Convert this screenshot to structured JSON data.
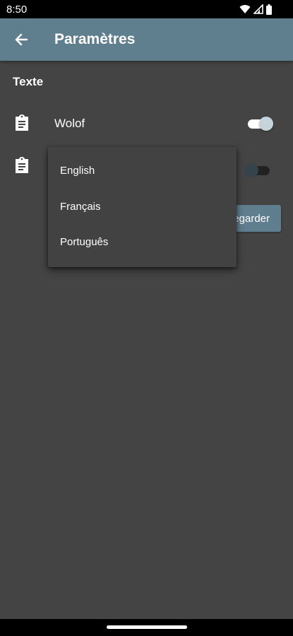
{
  "status_bar": {
    "time": "8:50",
    "icons": [
      "wifi-icon",
      "signal-icon",
      "battery-icon"
    ]
  },
  "app_bar": {
    "title": "Paramètres",
    "back_icon": "arrow-back-icon",
    "color": "#5f7e8e"
  },
  "section": {
    "title": "Texte"
  },
  "rows": [
    {
      "label": "Wolof",
      "icon": "clipboard-icon",
      "switch_on": true
    },
    {
      "label": "",
      "icon": "clipboard-icon",
      "switch_on": false
    }
  ],
  "save_button": {
    "label": "egarder"
  },
  "menu": {
    "items": [
      {
        "label": "English"
      },
      {
        "label": "Français"
      },
      {
        "label": "Português"
      }
    ]
  },
  "colors": {
    "background": "#444444",
    "accent": "#5f7e8e"
  }
}
